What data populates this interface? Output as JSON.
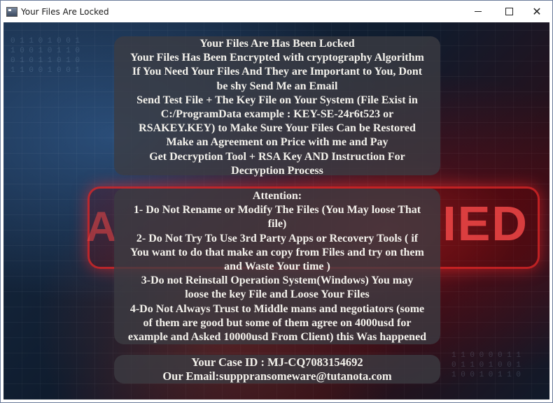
{
  "window": {
    "title": "Your Files Are Locked",
    "controls": {
      "minimize": "minimize",
      "maximize": "maximize",
      "close": "✕"
    }
  },
  "background": {
    "word_right": "IED",
    "word_left": "A"
  },
  "notice": {
    "lines": [
      "Your Files Are Has Been Locked",
      "Your Files Has Been Encrypted with cryptography Algorithm",
      "If You Need Your Files And They are Important to You, Dont",
      "be shy Send Me an Email",
      "Send Test File + The Key File on Your System (File Exist in",
      "C:/ProgramData example : KEY-SE-24r6t523 or",
      "RSAKEY.KEY) to Make Sure Your Files Can be Restored",
      "Make an Agreement on Price with me and Pay",
      "Get Decryption Tool + RSA Key AND Instruction For",
      "Decryption Process"
    ]
  },
  "attention": {
    "lines": [
      "Attention:",
      "1- Do Not Rename or Modify The Files (You May loose That",
      "file)",
      "2- Do Not Try To Use 3rd Party Apps or Recovery Tools ( if",
      "You want to do that make an copy from Files and try on them",
      "and Waste Your time )",
      "3-Do not Reinstall Operation System(Windows) You may",
      "loose the key File and Loose Your Files",
      "4-Do Not Always Trust to Middle mans and negotiators (some",
      "of them are good but some of them agree on 4000usd for",
      "example and Asked 10000usd From Client) this Was happened"
    ]
  },
  "contact": {
    "case_id_line": "Your Case ID : MJ-CQ7083154692",
    "email_line": "Our Email:supppransomeware@tutanota.com"
  }
}
